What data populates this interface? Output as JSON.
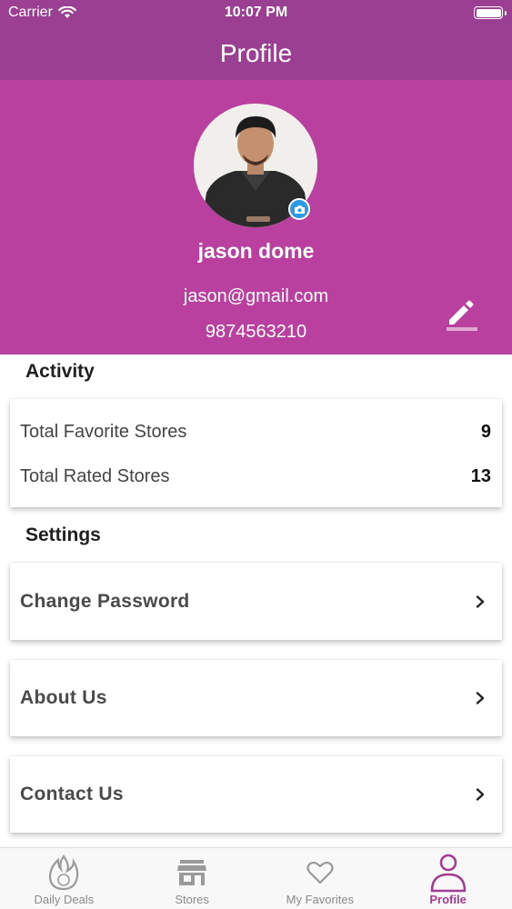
{
  "status_bar": {
    "carrier": "Carrier",
    "time": "10:07 PM",
    "battery_level": 1.0
  },
  "nav": {
    "title": "Profile"
  },
  "profile": {
    "name": "jason dome",
    "email": "jason@gmail.com",
    "phone": "9874563210",
    "icons": {
      "camera": "camera-icon",
      "edit": "pencil-icon"
    }
  },
  "activity": {
    "title": "Activity",
    "rows": [
      {
        "label": "Total Favorite Stores",
        "value": "9"
      },
      {
        "label": "Total Rated Stores",
        "value": "13"
      }
    ]
  },
  "settings": {
    "title": "Settings",
    "items": [
      {
        "label": "Change Password",
        "icon": "chevron-right-icon"
      },
      {
        "label": "About Us",
        "icon": "chevron-right-icon"
      },
      {
        "label": "Contact Us",
        "icon": "chevron-right-icon"
      }
    ]
  },
  "tabbar": {
    "tabs": [
      {
        "label": "Daily Deals",
        "icon": "flame-icon",
        "active": false
      },
      {
        "label": "Stores",
        "icon": "store-icon",
        "active": false
      },
      {
        "label": "My Favorites",
        "icon": "heart-icon",
        "active": false
      },
      {
        "label": "Profile",
        "icon": "person-icon",
        "active": true
      }
    ]
  },
  "colors": {
    "nav_bar": "#9b3f92",
    "header": "#b9409e",
    "active_tab": "#a33c95",
    "camera_badge": "#2c9ae6"
  }
}
